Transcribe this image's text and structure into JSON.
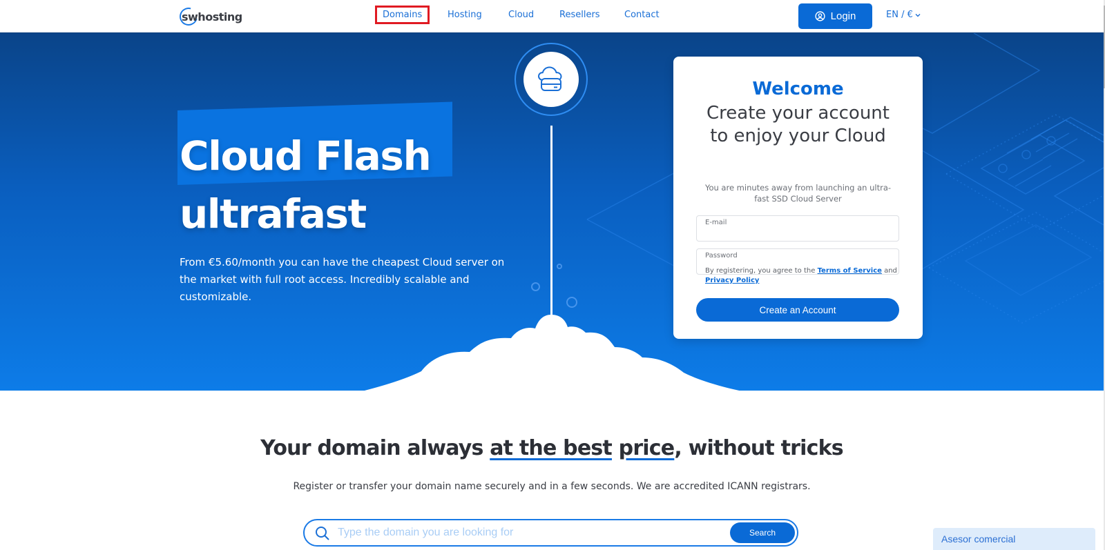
{
  "header": {
    "logo": "swhosting",
    "nav": [
      {
        "label": "Domains",
        "active": true
      },
      {
        "label": "Hosting",
        "active": false
      },
      {
        "label": "Cloud",
        "active": false
      },
      {
        "label": "Resellers",
        "active": false
      },
      {
        "label": "Contact",
        "active": false
      }
    ],
    "login_label": "Login",
    "lang_label": "EN / €"
  },
  "hero": {
    "title_line1": "Cloud Flash",
    "title_line2": "ultrafast",
    "subtitle": "From €5.60/month you can have the cheapest Cloud server on the market with full root access. Incredibly scalable and customizable.",
    "icon": "cloud-server-icon"
  },
  "signup": {
    "welcome": "Welcome",
    "heading_line1": "Create your account",
    "heading_line2": "to enjoy your Cloud",
    "description": "You are minutes away from launching an ultra-fast SSD Cloud Server",
    "email_label": "E-mail",
    "email_value": "",
    "password_label": "Password",
    "password_value": "",
    "terms_prefix": "By registering, you agree to the ",
    "terms_link": "Terms of Service",
    "terms_and": " and ",
    "privacy_link": "Privacy Policy",
    "create_label": "Create an Account"
  },
  "domains": {
    "title_before": "Your domain always ",
    "title_u1": "at the best",
    "title_space": " ",
    "title_u2": "price",
    "title_after": ", without tricks",
    "subtitle": "Register or transfer your domain name securely and in a few seconds. We are accredited ICANN registrars.",
    "search_placeholder": "Type the domain you are looking for",
    "search_value": "",
    "search_label": "Search"
  },
  "chat": {
    "label": "Asesor comercial"
  },
  "colors": {
    "brand_blue": "#0a6ad6",
    "active_outline": "#e01a22",
    "hero_top": "#0a4489",
    "hero_bottom": "#0d7ce8"
  }
}
